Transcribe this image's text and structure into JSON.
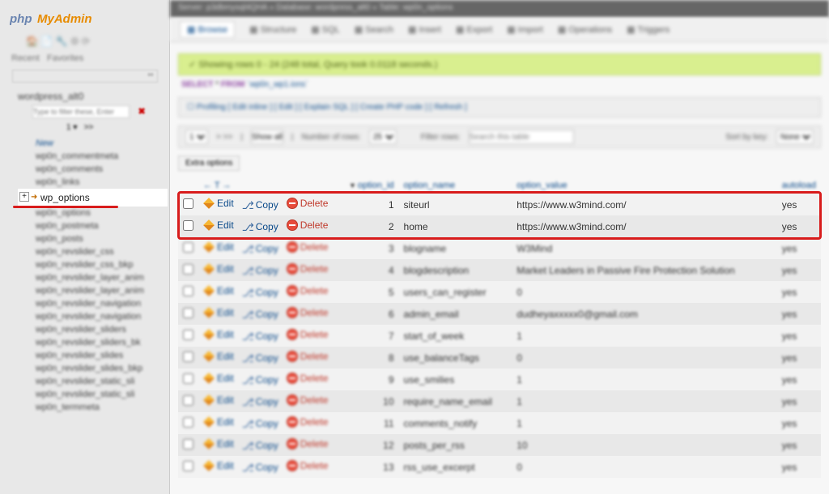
{
  "logo_alt": "phpMyAdmin",
  "sidebar_tabs": {
    "recent": "Recent",
    "favorites": "Favorites"
  },
  "db_name": "wordpress_alt0",
  "filter_placeholder": "Type to filter these, Enter",
  "tree_new": "New",
  "tree_focused": "wp_options",
  "tree_blurred": [
    "wp0n_commentmeta",
    "wp0n_comments",
    "wp0n_links",
    "wp0n_options",
    "wp0n_postmeta",
    "wp0n_posts",
    "wp0n_revslider_css",
    "wp0n_revslider_css_bkp",
    "wp0n_revslider_layer_anim",
    "wp0n_revslider_layer_anim",
    "wp0n_revslider_navigation",
    "wp0n_revslider_navigation",
    "wp0n_revslider_sliders",
    "wp0n_revslider_sliders_bk",
    "wp0n_revslider_slides",
    "wp0n_revslider_slides_bkp",
    "wp0n_revslider_static_sli",
    "wp0n_revslider_static_sli",
    "wp0n_termmeta"
  ],
  "breadcrumb": "Server: p3dbmysql4QHA   »   Database: wordpress_alt0   »   Table: wp0n_options",
  "topnav": [
    "Browse",
    "Structure",
    "SQL",
    "Search",
    "Insert",
    "Export",
    "Import",
    "Operations",
    "Triggers"
  ],
  "success_msg": "✓ Showing rows 0 - 24 (248 total, Query took 0.0118 seconds.)",
  "sql": {
    "kw1": "SELECT",
    "star": "*",
    "kw2": "FROM",
    "tbl": "`wp0n_wp1.ions`"
  },
  "profile_bar": "☐ Profiling [ Edit inline ] [ Edit ] [ Explain SQL ] [ Create PHP code ] [ Refresh ]",
  "controls": {
    "page": "1",
    "showall": "Show all",
    "numrows_label": "Number of rows:",
    "numrows": "25",
    "filter_label": "Filter rows:",
    "filter_ph": "Search this table",
    "sort_label": "Sort by key:",
    "sort_val": "None"
  },
  "extra_opts": "Extra options",
  "columns": {
    "id": "option_id",
    "name": "option_name",
    "value": "option_value",
    "auto": "autoload"
  },
  "action_labels": {
    "edit": "Edit",
    "copy": "Copy",
    "delete": "Delete"
  },
  "rows": [
    {
      "id": "1",
      "name": "siteurl",
      "value": "https://www.w3mind.com/",
      "auto": "yes",
      "sharp": true
    },
    {
      "id": "2",
      "name": "home",
      "value": "https://www.w3mind.com/",
      "auto": "yes",
      "sharp": true
    },
    {
      "id": "3",
      "name": "blogname",
      "value": "W3Mind",
      "auto": "yes"
    },
    {
      "id": "4",
      "name": "blogdescription",
      "value": "Market Leaders in Passive Fire Protection Solution",
      "auto": "yes"
    },
    {
      "id": "5",
      "name": "users_can_register",
      "value": "0",
      "auto": "yes"
    },
    {
      "id": "6",
      "name": "admin_email",
      "value": "dudheyaxxxxx0@gmail.com",
      "auto": "yes"
    },
    {
      "id": "7",
      "name": "start_of_week",
      "value": "1",
      "auto": "yes"
    },
    {
      "id": "8",
      "name": "use_balanceTags",
      "value": "0",
      "auto": "yes"
    },
    {
      "id": "9",
      "name": "use_smilies",
      "value": "1",
      "auto": "yes"
    },
    {
      "id": "10",
      "name": "require_name_email",
      "value": "1",
      "auto": "yes"
    },
    {
      "id": "11",
      "name": "comments_notify",
      "value": "1",
      "auto": "yes"
    },
    {
      "id": "12",
      "name": "posts_per_rss",
      "value": "10",
      "auto": "yes"
    },
    {
      "id": "13",
      "name": "rss_use_excerpt",
      "value": "0",
      "auto": "yes"
    }
  ]
}
